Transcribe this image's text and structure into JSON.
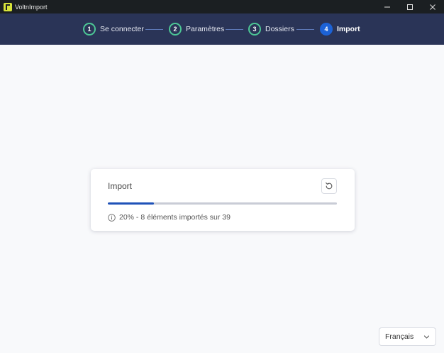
{
  "window": {
    "title": "VoltnImport",
    "controls": [
      "minimize-icon",
      "maximize-icon",
      "close-icon"
    ]
  },
  "stepper": {
    "steps": [
      {
        "number": "1",
        "label": "Se connecter",
        "state": "done"
      },
      {
        "number": "2",
        "label": "Paramètres",
        "state": "done"
      },
      {
        "number": "3",
        "label": "Dossiers",
        "state": "done"
      },
      {
        "number": "4",
        "label": "Import",
        "state": "active"
      }
    ]
  },
  "import_card": {
    "title": "Import",
    "progress_percent": 20,
    "status_text": "20% - 8 éléments importés sur 39",
    "refresh_icon": "refresh-icon",
    "info_icon": "info-icon"
  },
  "language": {
    "selected": "Français",
    "icon": "chevron-down-icon"
  },
  "colors": {
    "titlebar": "#1b1f22",
    "header": "#2a3457",
    "step_done": "#4cc695",
    "step_active": "#1c62d6",
    "progress_fill": "#1f52b8",
    "background": "#f8f9fb"
  }
}
